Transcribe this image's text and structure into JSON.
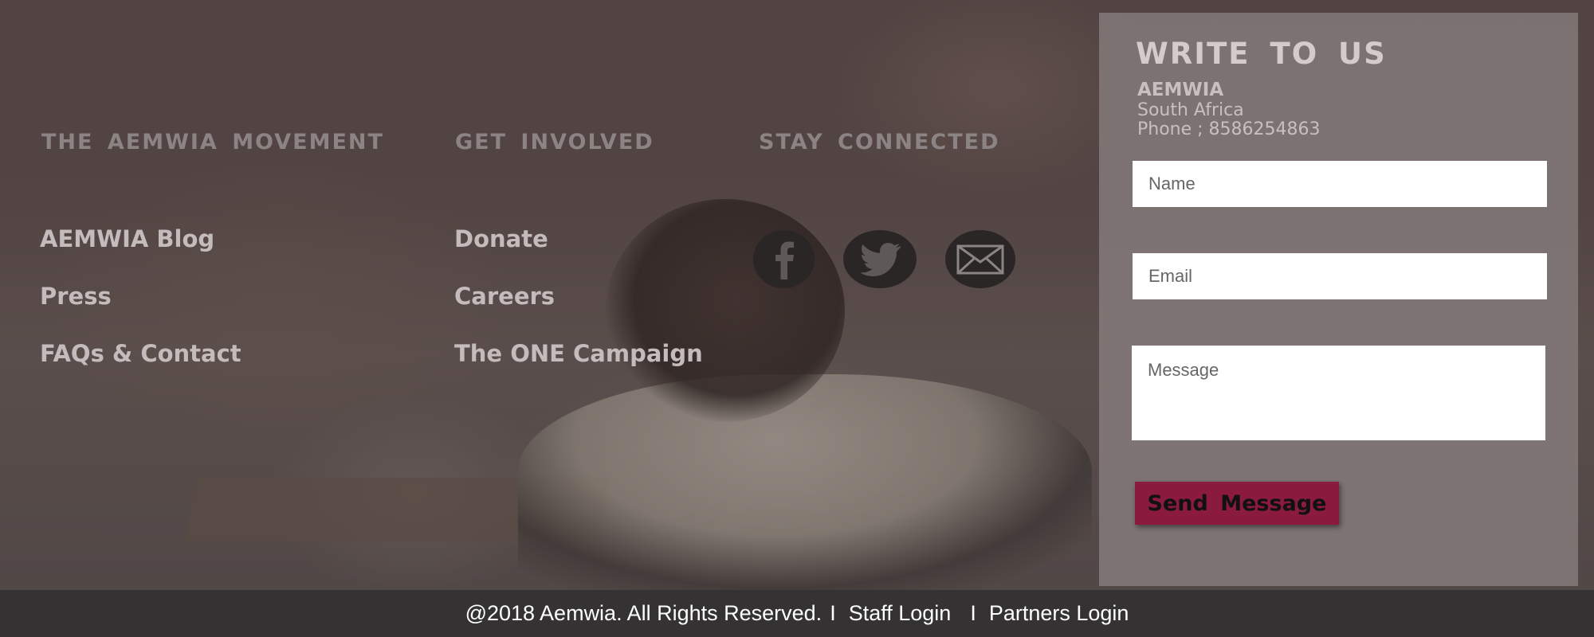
{
  "columns": {
    "movement": {
      "heading": "THE AEMWIA MOVEMENT",
      "links": [
        "AEMWIA Blog",
        "Press",
        "FAQs & Contact"
      ]
    },
    "involved": {
      "heading": "GET INVOLVED",
      "links": [
        "Donate",
        "Careers",
        "The ONE Campaign"
      ]
    },
    "connected": {
      "heading": "STAY CONNECTED",
      "icons": [
        "facebook-icon",
        "twitter-icon",
        "email-icon"
      ]
    }
  },
  "contact": {
    "title": "WRITE TO US",
    "org_name": "AEMWIA",
    "location": "South Africa",
    "phone": "Phone ;  8586254863",
    "name_placeholder": "Name",
    "email_placeholder": "Email",
    "message_placeholder": "Message",
    "send_label": "Send  Message",
    "button_color": "#8a1a3e"
  },
  "footer": {
    "copyright": "@2018 Aemwia. All Rights Reserved.",
    "separator": "I",
    "staff_login": "Staff Login",
    "partners_login": "Partners Login"
  }
}
